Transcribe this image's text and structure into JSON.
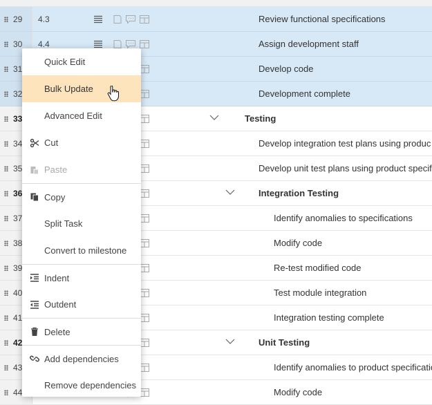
{
  "rows": [
    {
      "num": "29",
      "wbs": "4.3",
      "name": "Review functional specifications",
      "selected": true,
      "summary": false,
      "level": 1
    },
    {
      "num": "30",
      "wbs": "4.4",
      "name": "Assign development staff",
      "selected": true,
      "summary": false,
      "level": 1
    },
    {
      "num": "31",
      "wbs": "",
      "name": "Develop code",
      "selected": true,
      "summary": false,
      "level": 1
    },
    {
      "num": "32",
      "wbs": "",
      "name": "Development complete",
      "selected": true,
      "summary": false,
      "level": 1
    },
    {
      "num": "33",
      "wbs": "",
      "name": "Testing",
      "selected": false,
      "summary": true,
      "level": 0
    },
    {
      "num": "34",
      "wbs": "",
      "name": "Develop integration test plans using produc",
      "selected": false,
      "summary": false,
      "level": 1
    },
    {
      "num": "35",
      "wbs": "",
      "name": "Develop unit test plans using product specif",
      "selected": false,
      "summary": false,
      "level": 1
    },
    {
      "num": "36",
      "wbs": "",
      "name": "Integration Testing",
      "selected": false,
      "summary": true,
      "level": 1
    },
    {
      "num": "37",
      "wbs": "",
      "name": "Identify anomalies to specifications",
      "selected": false,
      "summary": false,
      "level": 2
    },
    {
      "num": "38",
      "wbs": "",
      "name": "Modify code",
      "selected": false,
      "summary": false,
      "level": 2
    },
    {
      "num": "39",
      "wbs": "",
      "name": "Re-test modified code",
      "selected": false,
      "summary": false,
      "level": 2
    },
    {
      "num": "40",
      "wbs": "",
      "name": "Test module integration",
      "selected": false,
      "summary": false,
      "level": 2
    },
    {
      "num": "41",
      "wbs": "",
      "name": "Integration testing complete",
      "selected": false,
      "summary": false,
      "level": 2
    },
    {
      "num": "42",
      "wbs": "",
      "name": "Unit Testing",
      "selected": false,
      "summary": true,
      "level": 1
    },
    {
      "num": "43",
      "wbs": "",
      "name": "Identify anomalies to product specificatio",
      "selected": false,
      "summary": false,
      "level": 2
    },
    {
      "num": "44",
      "wbs": "",
      "name": "Modify code",
      "selected": false,
      "summary": false,
      "level": 2
    }
  ],
  "menu": [
    {
      "label": "Quick Edit",
      "icon": "",
      "disabled": false,
      "hover": false,
      "separator": false
    },
    {
      "label": "Bulk Update",
      "icon": "",
      "disabled": false,
      "hover": true,
      "separator": false
    },
    {
      "label": "Advanced Edit",
      "icon": "",
      "disabled": false,
      "hover": false,
      "separator": false
    },
    {
      "label": "Cut",
      "icon": "scissors-icon",
      "disabled": false,
      "hover": false,
      "separator": false
    },
    {
      "label": "Paste",
      "icon": "paste-icon",
      "disabled": true,
      "hover": false,
      "separator": false
    },
    {
      "label": "Copy",
      "icon": "copy-icon",
      "disabled": false,
      "hover": false,
      "separator": true
    },
    {
      "label": "Split Task",
      "icon": "",
      "disabled": false,
      "hover": false,
      "separator": false
    },
    {
      "label": "Convert to milestone",
      "icon": "",
      "disabled": false,
      "hover": false,
      "separator": false
    },
    {
      "label": "Indent",
      "icon": "indent-icon",
      "disabled": false,
      "hover": false,
      "separator": true
    },
    {
      "label": "Outdent",
      "icon": "outdent-icon",
      "disabled": false,
      "hover": false,
      "separator": false
    },
    {
      "label": "Delete",
      "icon": "trash-icon",
      "disabled": false,
      "hover": false,
      "separator": true
    },
    {
      "label": "Add dependencies",
      "icon": "link-icon",
      "disabled": false,
      "hover": false,
      "separator": true
    },
    {
      "label": "Remove dependencies",
      "icon": "",
      "disabled": false,
      "hover": false,
      "separator": false
    }
  ]
}
